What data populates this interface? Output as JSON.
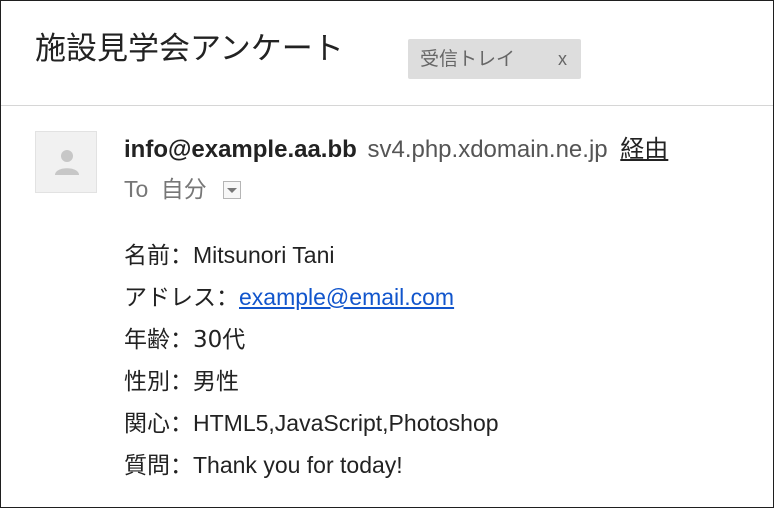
{
  "message": {
    "subject": "施設見学会アンケート",
    "label": {
      "name": "受信トレイ",
      "remove_glyph": "x"
    }
  },
  "sender": {
    "email": "info@example.aa.bb",
    "via_domain": "sv4.php.xdomain.ne.jp",
    "via_label": "経由",
    "avatar_icon": "person-icon"
  },
  "recipient": {
    "to_label": "To",
    "name": "自分",
    "toggle_icon": "chevron-down-icon"
  },
  "body": {
    "separator": "：",
    "fields": [
      {
        "label": "名前",
        "value": "Mitsunori Tani"
      },
      {
        "label": "アドレス",
        "value": "example@email.com"
      },
      {
        "label": "年齢",
        "value": "30代"
      },
      {
        "label": "性別",
        "value": "男性"
      },
      {
        "label": "関心",
        "value": "HTML5,JavaScript,Photoshop"
      },
      {
        "label": "質問",
        "value": "Thank you for today!"
      }
    ]
  },
  "colors": {
    "link": "#1155cc",
    "label_chip_bg": "#dddddd",
    "divider": "#d6d6d6"
  }
}
